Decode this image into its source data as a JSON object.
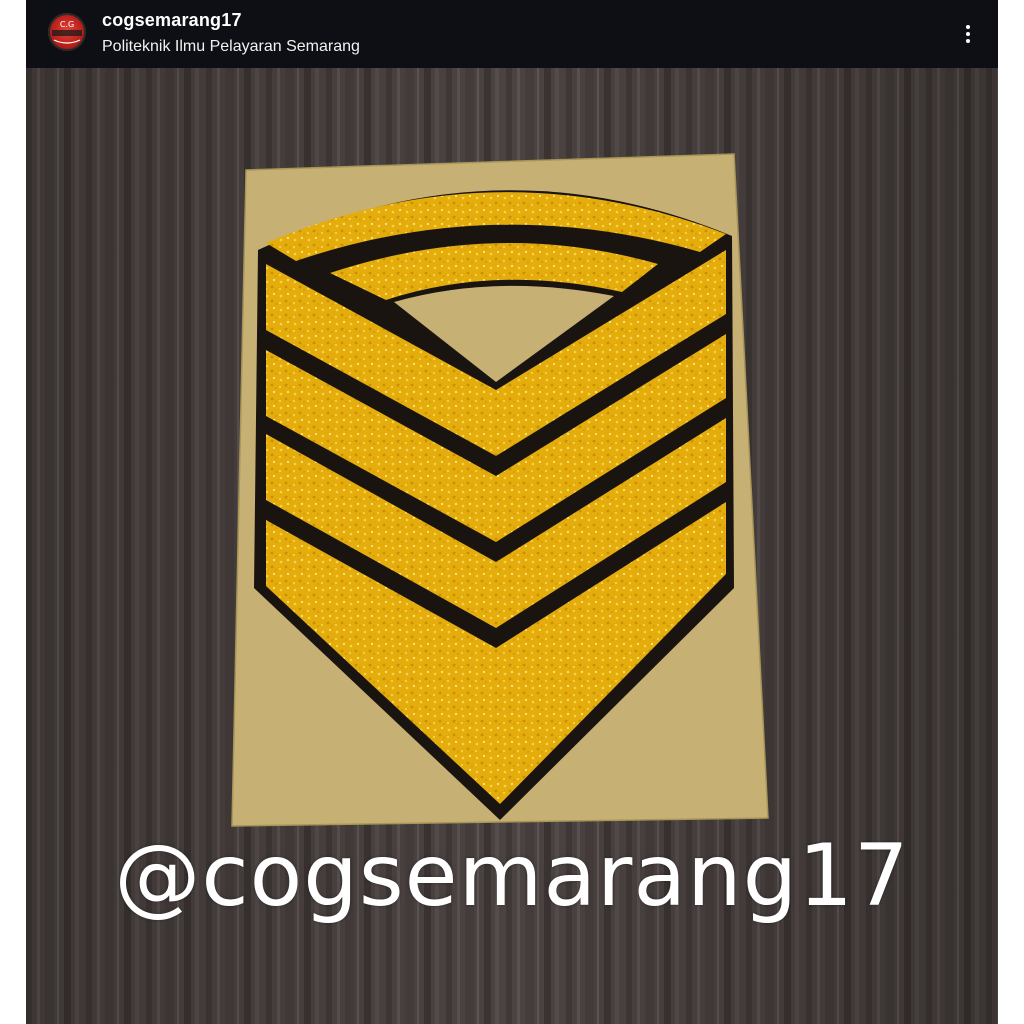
{
  "post": {
    "username": "cogsemarang17",
    "location": "Politeknik Ilmu Pelayaran Semarang",
    "more_icon": "more-vertical-icon",
    "watermark": "@cogsemarang17"
  },
  "colors": {
    "topbar": "#0d0f14",
    "wood": "#4a4240",
    "sticker_backing": "#c8b274",
    "chevron_gold": "#e6b10d",
    "chevron_outline": "#1a1410"
  }
}
